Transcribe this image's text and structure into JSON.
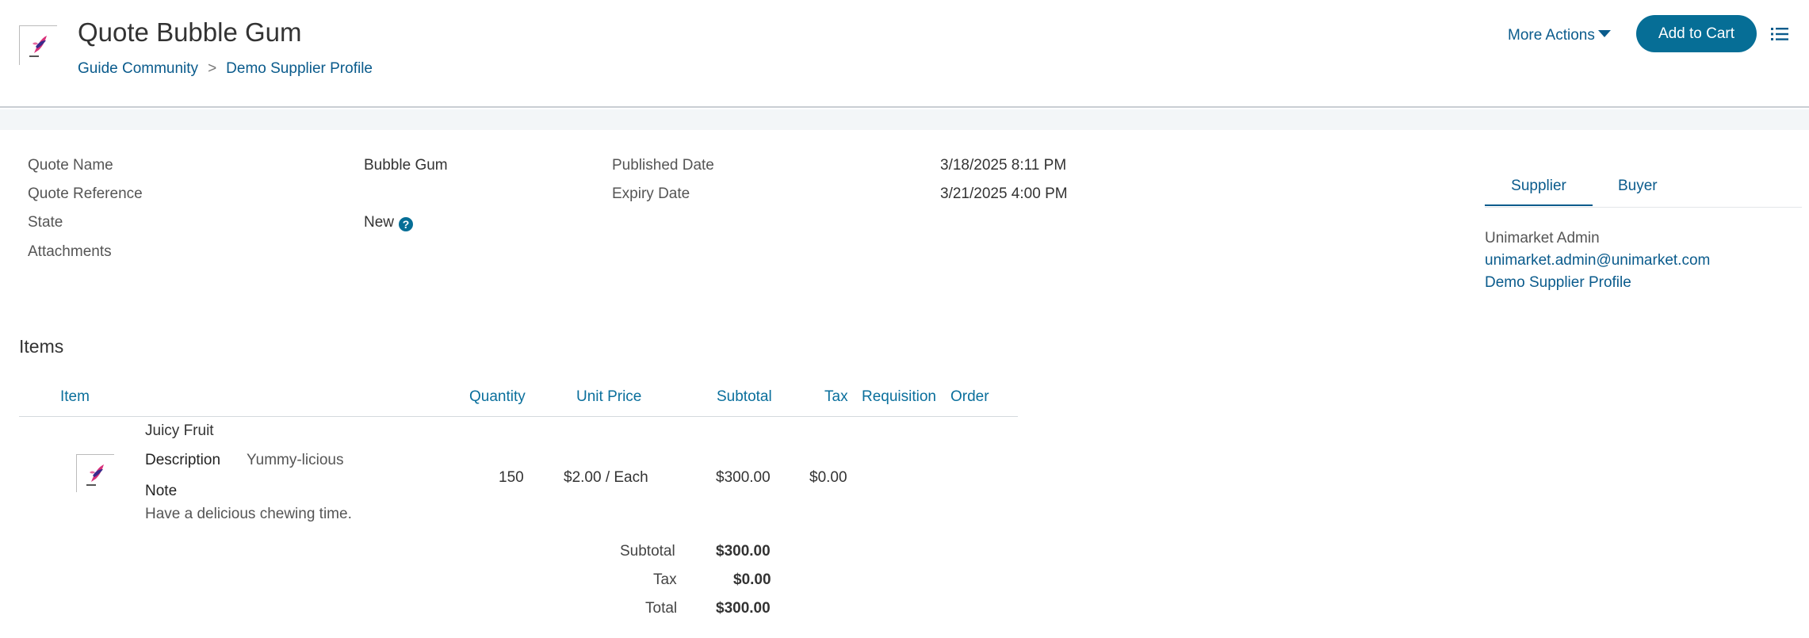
{
  "header": {
    "title": "Quote Bubble Gum",
    "breadcrumb": [
      "Guide Community",
      "Demo Supplier Profile"
    ],
    "breadcrumb_separator": ">",
    "more_actions_label": "More Actions",
    "add_to_cart_label": "Add to Cart"
  },
  "details": {
    "quote_name_label": "Quote Name",
    "quote_name_value": "Bubble Gum",
    "quote_reference_label": "Quote Reference",
    "state_label": "State",
    "state_value": "New",
    "attachments_label": "Attachments",
    "published_date_label": "Published Date",
    "published_date_value": "3/18/2025 8:11 PM",
    "expiry_date_label": "Expiry Date",
    "expiry_date_value": "3/21/2025 4:00 PM"
  },
  "side_panel": {
    "tabs": [
      "Supplier",
      "Buyer"
    ],
    "active_tab": "Supplier",
    "contact_name": "Unimarket Admin",
    "contact_email": "unimarket.admin@unimarket.com",
    "organization": "Demo Supplier Profile"
  },
  "items": {
    "title": "Items",
    "columns": [
      "Item",
      "Quantity",
      "Unit Price",
      "Subtotal",
      "Tax",
      "Requisition",
      "Order"
    ],
    "rows": [
      {
        "name": "Juicy Fruit",
        "description_label": "Description",
        "description": "Yummy-licious",
        "note_label": "Note",
        "note": "Have a delicious chewing time.",
        "quantity": "150",
        "unit_price": "$2.00 / Each",
        "subtotal": "$300.00",
        "tax": "$0.00"
      }
    ],
    "totals": {
      "subtotal_label": "Subtotal",
      "subtotal": "$300.00",
      "tax_label": "Tax",
      "tax": "$0.00",
      "total_label": "Total",
      "total": "$300.00"
    }
  },
  "colors": {
    "link": "#0a5b8c",
    "primary_button": "#066e96",
    "band": "#f3f6f8"
  },
  "icons": [
    "logo-icon",
    "caret-down-icon",
    "list-icon",
    "help-icon",
    "product-image"
  ]
}
